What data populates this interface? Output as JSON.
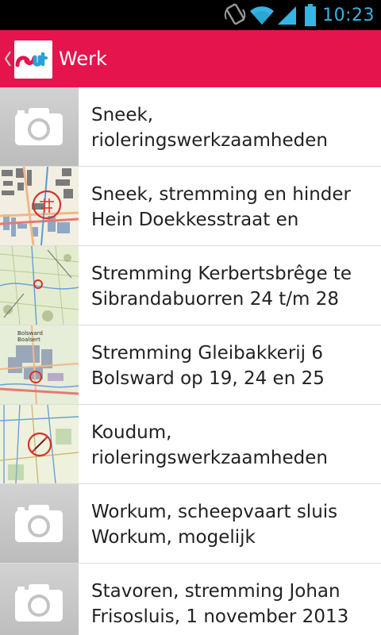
{
  "status_bar": {
    "time": "10:23",
    "icons": [
      "screen-rotation-icon",
      "wifi-icon",
      "signal-icon",
      "battery-icon"
    ]
  },
  "action_bar": {
    "title": "Werk",
    "logo": "app-logo-icon",
    "up": "up-caret-icon",
    "color": "#e5144c"
  },
  "items": [
    {
      "title": "Sneek,\nrioleringswerkzaamheden",
      "thumbnail": "camera-placeholder"
    },
    {
      "title": "Sneek, stremming en hinder\nHein Doekkesstraat en",
      "thumbnail": "map-city"
    },
    {
      "title": "Stremming Kerbertsbrêge te\nSibrandabuorren 24 t/m 28",
      "thumbnail": "map-rural"
    },
    {
      "title": "Stremming Gleibakkerij 6\nBolsward op 19, 24 en 25",
      "thumbnail": "map-town"
    },
    {
      "title": "Koudum,\nrioleringswerkzaamheden",
      "thumbnail": "map-fields"
    },
    {
      "title": "Workum, scheepvaart sluis\nWorkum, mogelijk",
      "thumbnail": "camera-placeholder"
    },
    {
      "title": "Stavoren, stremming Johan\nFrisosluis, 1 november 2013",
      "thumbnail": "camera-placeholder"
    }
  ],
  "map_labels": {
    "item3": "Bolsward\nBoalsert"
  }
}
